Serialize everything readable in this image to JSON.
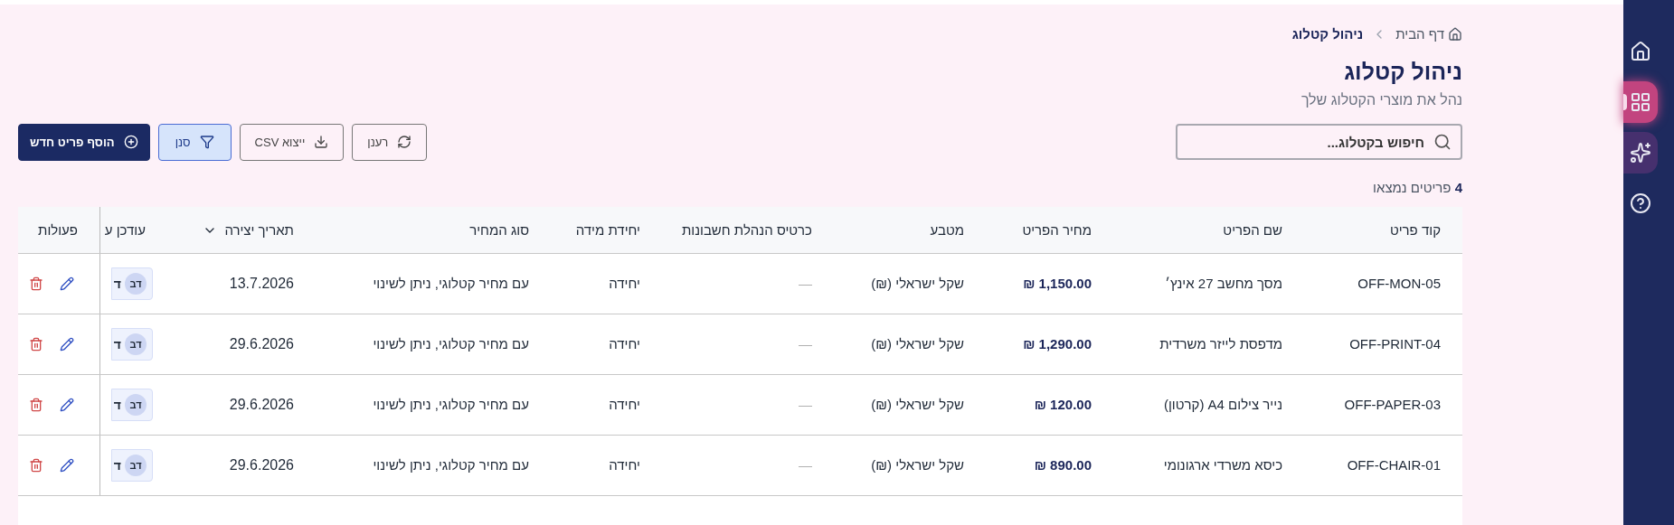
{
  "breadcrumb": [
    {
      "label": "דף הבית",
      "kind": "home"
    },
    {
      "label": "ניהול קטלוג",
      "kind": "current"
    }
  ],
  "title": "ניהול קטלוג",
  "subtitle": "נהל את מוצרי הקטלוג שלך",
  "search": {
    "placeholder": "חיפוש בקטלוג..."
  },
  "toolbar": [
    {
      "label": "רענן",
      "kind": "refresh",
      "selected": false
    },
    {
      "label": "ייצוא CSV",
      "kind": "export",
      "selected": false
    },
    {
      "label": "סנן",
      "kind": "filter",
      "selected": true
    },
    {
      "label": "הוסף פריט חדש",
      "kind": "add",
      "selected": false
    }
  ],
  "result_count": {
    "count": "4",
    "label": "פריטים נמצאו"
  },
  "table": {
    "columns": [
      {
        "label": "קוד פריט"
      },
      {
        "label": "שם הפריט"
      },
      {
        "label": "מחיר הפריט"
      },
      {
        "label": "מטבע"
      },
      {
        "label": "כרטיס הנהלת חשבונות"
      },
      {
        "label": "יחידת מידה"
      },
      {
        "label": "סוג המחיר"
      },
      {
        "label": "תאריך יצירה",
        "sorted": true
      },
      {
        "label": "עודכן ע"
      },
      {
        "label": "פעולות"
      }
    ],
    "rows": [
      {
        "code": "OFF-MON-05",
        "name": "מסך מחשב 27 אינץ׳",
        "price": "1,150.00 ₪",
        "currency": "שקל ישראלי (₪)",
        "account": "—",
        "unit": "יחידה",
        "price_type": "עם מחיר קטלוגי, ניתן לשינוי",
        "created": "13.7.2026",
        "updated_by": {
          "initials": "דב",
          "name": "ד"
        }
      },
      {
        "code": "OFF-PRINT-04",
        "name": "מדפסת לייזר משרדית",
        "price": "1,290.00 ₪",
        "currency": "שקל ישראלי (₪)",
        "account": "—",
        "unit": "יחידה",
        "price_type": "עם מחיר קטלוגי, ניתן לשינוי",
        "created": "29.6.2026",
        "updated_by": {
          "initials": "דב",
          "name": "ד"
        }
      },
      {
        "code": "OFF-PAPER-03",
        "name": "נייר צילום A4 (קרטון)",
        "price": "120.00 ₪",
        "currency": "שקל ישראלי (₪)",
        "account": "—",
        "unit": "יחידה",
        "price_type": "עם מחיר קטלוגי, ניתן לשינוי",
        "created": "29.6.2026",
        "updated_by": {
          "initials": "דב",
          "name": "ד"
        }
      },
      {
        "code": "OFF-CHAIR-01",
        "name": "כיסא משרדי ארגונומי",
        "price": "890.00 ₪",
        "currency": "שקל ישראלי (₪)",
        "account": "—",
        "unit": "יחידה",
        "price_type": "עם מחיר קטלוגי, ניתן לשינוי",
        "created": "29.6.2026",
        "updated_by": {
          "initials": "דב",
          "name": "ד"
        }
      }
    ]
  },
  "sidebar": {
    "items": [
      {
        "kind": "home",
        "selected": false
      },
      {
        "kind": "grid",
        "selected": true
      },
      {
        "kind": "sparkle",
        "selected": false
      },
      {
        "kind": "help",
        "selected": false
      }
    ]
  }
}
